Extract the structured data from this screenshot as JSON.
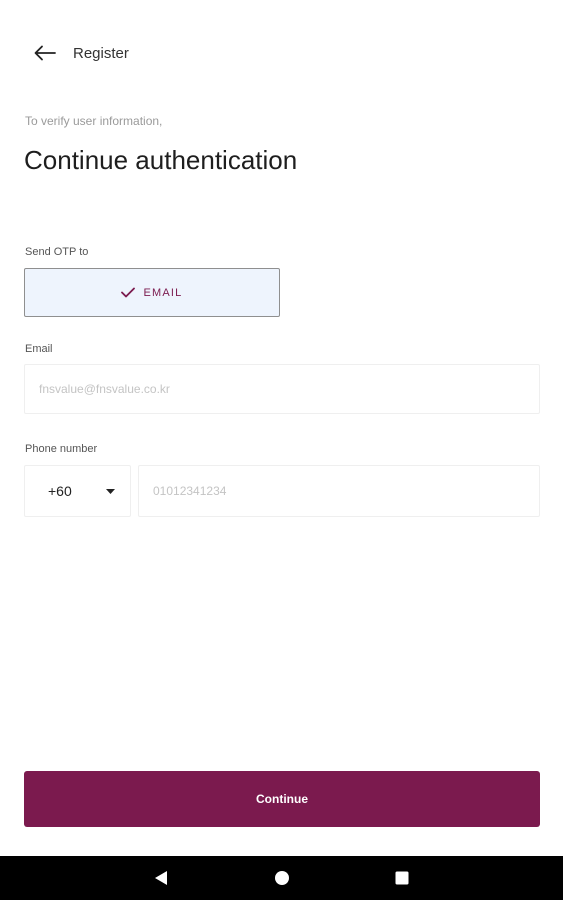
{
  "header": {
    "title": "Register",
    "back_icon": "arrow-left-icon"
  },
  "intro": {
    "subtitle": "To verify user information,",
    "title": "Continue authentication"
  },
  "otp": {
    "label": "Send OTP to",
    "selected_option": "EMAIL",
    "check_icon": "check-icon",
    "selected_bg": "#eef4fd"
  },
  "email": {
    "label": "Email",
    "placeholder": "fnsvalue@fnsvalue.co.kr",
    "value": ""
  },
  "phone": {
    "label": "Phone number",
    "country_code": "+60",
    "dropdown_icon": "caret-down-icon",
    "placeholder": "01012341234",
    "value": ""
  },
  "actions": {
    "continue_label": "Continue",
    "accent_color": "#7b1a4e"
  },
  "system_nav": {
    "back_icon": "nav-back-icon",
    "home_icon": "nav-home-icon",
    "recent_icon": "nav-recent-icon"
  }
}
